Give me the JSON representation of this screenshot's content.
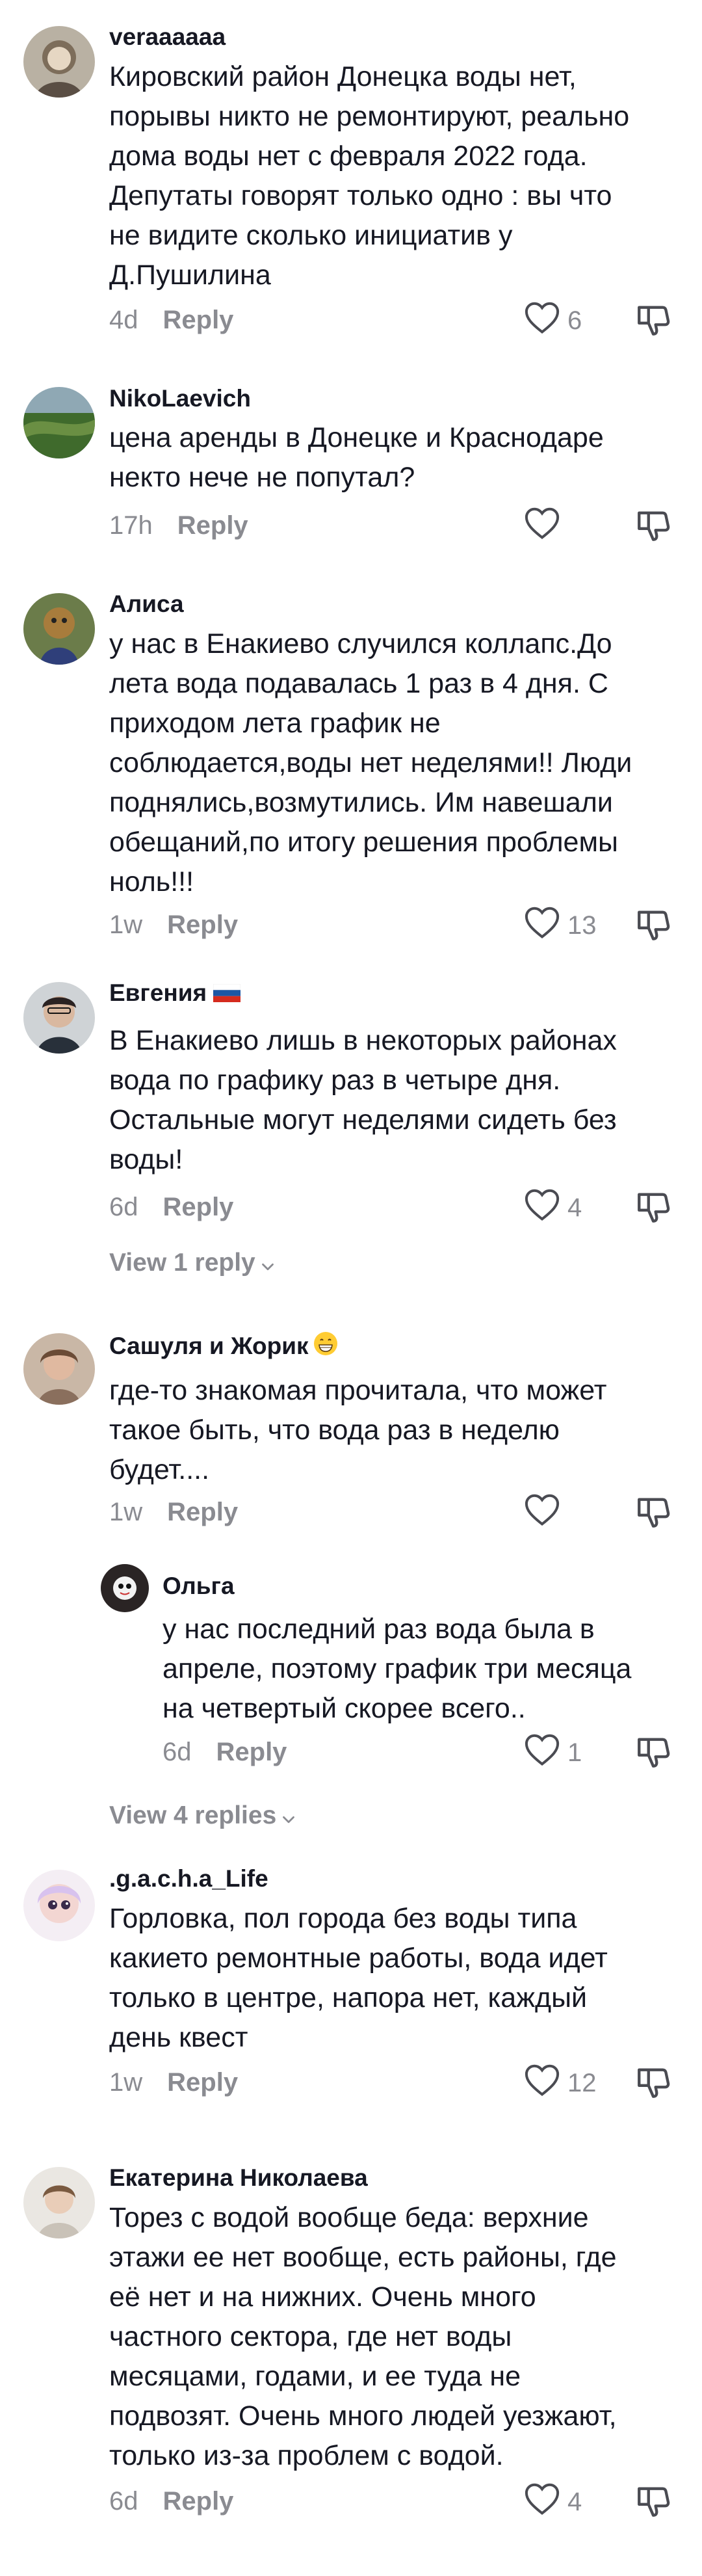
{
  "comments": [
    {
      "username": "veraaaaaa",
      "text": [
        "Кировский район Донецка воды нет,",
        "порывы никто не ремонтируют, реально",
        "дома воды нет с февраля 2022 года.",
        "Депутаты говорят только одно : вы что",
        "не видите сколько инициатив у",
        "Д.Пушилина"
      ],
      "time": "4d",
      "reply_label": "Reply",
      "likes": "6"
    },
    {
      "username": "NikoLaevich",
      "text": [
        "цена аренды в Донецке и Краснодаре",
        "некто нече не попутал?"
      ],
      "time": "17h",
      "reply_label": "Reply",
      "likes": ""
    },
    {
      "username": "Алиса",
      "text": [
        "у нас в Енакиево случился коллапс.До",
        "лета вода подавалась 1 раз в 4 дня. С",
        "приходом лета график не",
        "соблюдается,воды нет неделями!! Люди",
        "поднялись,возмутились. Им навешали",
        "обещаний,по итогу решения проблемы",
        "ноль!!!"
      ],
      "time": "1w",
      "reply_label": "Reply",
      "likes": "13"
    },
    {
      "username": "Евгения",
      "text": [
        "В Енакиево лишь в некоторых районах",
        "вода по графику раз в четыре дня.",
        "Остальные могут неделями сидеть без",
        "воды!"
      ],
      "time": "6d",
      "reply_label": "Reply",
      "likes": "4",
      "view_replies": "View 1 reply"
    },
    {
      "username": "Сашуля и Жорик",
      "text": [
        "где-то знакомая прочитала, что может",
        "такое быть, что вода раз в неделю",
        "будет...."
      ],
      "time": "1w",
      "reply_label": "Reply",
      "likes": ""
    },
    {
      "username": "Ольга",
      "text": [
        "у нас последний раз вода была в",
        "апреле, поэтому график три месяца",
        "на четвертый скорее всего.."
      ],
      "time": "6d",
      "reply_label": "Reply",
      "likes": "1",
      "view_replies": "View 4 replies"
    },
    {
      "username": ".g.a.c.h.a_Life",
      "text": [
        "Горловка, пол города без воды типа",
        "какието ремонтные работы, вода идет",
        "только в центре, напора нет, каждый",
        "день квест"
      ],
      "time": "1w",
      "reply_label": "Reply",
      "likes": "12"
    },
    {
      "username": "Екатерина Николаева",
      "text": [
        "Торез с водой вообще беда: верхние",
        "этажи ее нет вообще, есть районы, где",
        "её нет и на нижних. Очень много",
        "частного сектора, где нет воды",
        "месяцами, годами, и ее туда не",
        "подвозят. Очень много людей уезжают,",
        "только из-за проблем с водой."
      ],
      "time": "6d",
      "reply_label": "Reply",
      "likes": "4"
    }
  ],
  "colors": {
    "text": "#161823",
    "muted": "#8a8b91",
    "background": "#ffffff"
  },
  "icons": {
    "like": "heart-outline-icon",
    "dislike": "thumbs-down-icon",
    "more": "chevron-down-icon"
  }
}
